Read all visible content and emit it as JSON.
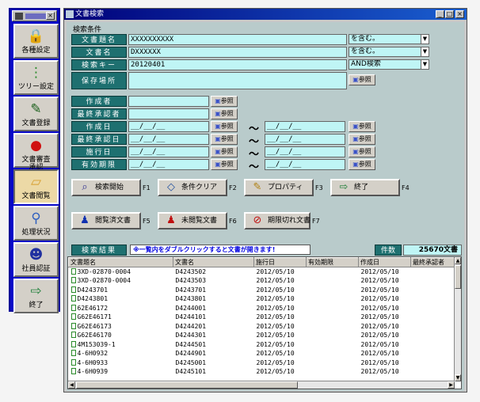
{
  "launcher": {
    "items": [
      {
        "label": "各種設定",
        "icon": "lock-icon"
      },
      {
        "label": "ツリー設定",
        "icon": "tree-icon"
      },
      {
        "label": "文書登録",
        "icon": "pencil-icon"
      },
      {
        "label": "文書審査\n承認",
        "icon": "approval-stamp-icon"
      },
      {
        "label": "文書閲覧",
        "icon": "folder-icon"
      },
      {
        "label": "処理状況",
        "icon": "magnifier-icon"
      },
      {
        "label": "社員認証",
        "icon": "people-icon"
      },
      {
        "label": "終了",
        "icon": "exit-door-icon"
      }
    ]
  },
  "window": {
    "title": "文書検索",
    "min": "_",
    "max": "□",
    "close": "×"
  },
  "conditions": {
    "section_title": "検索条件",
    "doc_name": {
      "label": "文書題名",
      "value": "XXXXXXXXXX",
      "mode": "を含む。"
    },
    "doc_file": {
      "label": "文書名",
      "value": "DXXXXXX",
      "mode": "を含む。"
    },
    "keyword": {
      "label": "検索キー",
      "value": "20120401",
      "mode": "AND検索"
    },
    "location": {
      "label": "保存場所",
      "value": ""
    },
    "author": {
      "label": "作成者",
      "value": ""
    },
    "final_approver": {
      "label": "最終承認者",
      "value": ""
    },
    "created": {
      "label": "作成日",
      "from": "__/__/__",
      "to": "__/__/__"
    },
    "final_approved": {
      "label": "最終承認日",
      "from": "__/__/__",
      "to": "__/__/__"
    },
    "effective": {
      "label": "施行日",
      "from": "__/__/__",
      "to": "__/__/__"
    },
    "expiry": {
      "label": "有効期限",
      "from": "__/__/__",
      "to": "__/__/__"
    },
    "ref": "参照",
    "tilde": "〜"
  },
  "actions": [
    {
      "label": "検索開始",
      "key": "F1",
      "icon": "search-start-icon"
    },
    {
      "label": "条件クリア",
      "key": "F2",
      "icon": "eraser-icon"
    },
    {
      "label": "プロパティ",
      "key": "F3",
      "icon": "property-icon"
    },
    {
      "label": "終了",
      "key": "F4",
      "icon": "exit-door-icon"
    },
    {
      "label": "閲覧済文書",
      "key": "F5",
      "icon": "read-user-icon"
    },
    {
      "label": "未閲覧文書",
      "key": "F6",
      "icon": "unread-user-icon"
    },
    {
      "label": "期限切れ文書",
      "key": "F7",
      "icon": "expired-icon"
    }
  ],
  "result_bar": {
    "label": "検索結果",
    "hint": "※一覧内をダブルクリックすると文書が開きます!",
    "count_label": "件数",
    "count_value": "25670文書"
  },
  "list": {
    "columns": [
      "文書題名",
      "文書名",
      "施行日",
      "有効期限",
      "作成日",
      "最終承認者"
    ],
    "rows": [
      [
        "3XD-02870-0004",
        "D4243502",
        "2012/05/10",
        "",
        "2012/05/10",
        ""
      ],
      [
        "3XD-02870-0004",
        "D4243503",
        "2012/05/10",
        "",
        "2012/05/10",
        ""
      ],
      [
        "D4243701",
        "D4243701",
        "2012/05/10",
        "",
        "2012/05/10",
        ""
      ],
      [
        "D4243801",
        "D4243801",
        "2012/05/10",
        "",
        "2012/05/10",
        ""
      ],
      [
        "62E46172",
        "D4244001",
        "2012/05/10",
        "",
        "2012/05/10",
        ""
      ],
      [
        "G62E46171",
        "D4244101",
        "2012/05/10",
        "",
        "2012/05/10",
        ""
      ],
      [
        "G62E46173",
        "D4244201",
        "2012/05/10",
        "",
        "2012/05/10",
        ""
      ],
      [
        "G62E46170",
        "D4244301",
        "2012/05/10",
        "",
        "2012/05/10",
        ""
      ],
      [
        "4M153039-1",
        "D4244501",
        "2012/05/10",
        "",
        "2012/05/10",
        ""
      ],
      [
        "4-6H0932",
        "D4244901",
        "2012/05/10",
        "",
        "2012/05/10",
        ""
      ],
      [
        "4-6H0933",
        "D4245001",
        "2012/05/10",
        "",
        "2012/05/10",
        ""
      ],
      [
        "4-6H0939",
        "D4245101",
        "2012/05/10",
        "",
        "2012/05/10",
        ""
      ]
    ]
  }
}
